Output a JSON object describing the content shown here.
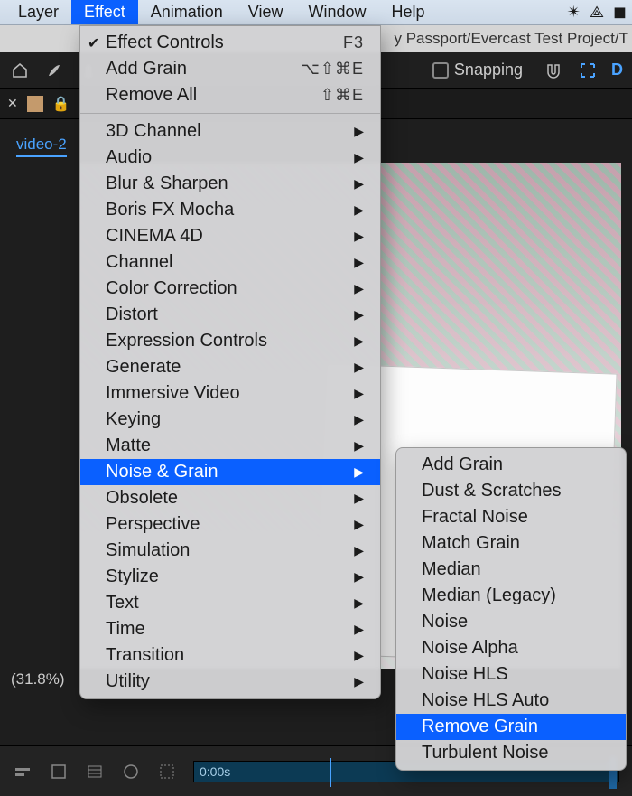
{
  "menubar": {
    "items": [
      "Layer",
      "Effect",
      "Animation",
      "View",
      "Window",
      "Help"
    ],
    "active_index": 1
  },
  "pathbar": {
    "text": "y Passport/Evercast Test Project/T"
  },
  "toolbar": {
    "snapping_label": "Snapping",
    "right_letter": "D"
  },
  "project_tab": {
    "label": "video-2"
  },
  "zoom": {
    "label": "(31.8%)"
  },
  "timeline": {
    "time_label": "0:00s"
  },
  "effect_menu": {
    "top": [
      {
        "label": "Effect Controls",
        "checked": true,
        "shortcut": "F3"
      },
      {
        "label": "Add Grain",
        "shortcut": "⌥⇧⌘E"
      },
      {
        "label": "Remove All",
        "shortcut": "⇧⌘E"
      }
    ],
    "categories": [
      {
        "label": "3D Channel"
      },
      {
        "label": "Audio"
      },
      {
        "label": "Blur & Sharpen"
      },
      {
        "label": "Boris FX Mocha"
      },
      {
        "label": "CINEMA 4D"
      },
      {
        "label": "Channel"
      },
      {
        "label": "Color Correction"
      },
      {
        "label": "Distort"
      },
      {
        "label": "Expression Controls"
      },
      {
        "label": "Generate"
      },
      {
        "label": "Immersive Video"
      },
      {
        "label": "Keying"
      },
      {
        "label": "Matte"
      },
      {
        "label": "Noise & Grain",
        "active": true
      },
      {
        "label": "Obsolete"
      },
      {
        "label": "Perspective"
      },
      {
        "label": "Simulation"
      },
      {
        "label": "Stylize"
      },
      {
        "label": "Text"
      },
      {
        "label": "Time"
      },
      {
        "label": "Transition"
      },
      {
        "label": "Utility"
      }
    ]
  },
  "noise_grain_submenu": {
    "items": [
      {
        "label": "Add Grain"
      },
      {
        "label": "Dust & Scratches"
      },
      {
        "label": "Fractal Noise"
      },
      {
        "label": "Match Grain"
      },
      {
        "label": "Median"
      },
      {
        "label": "Median (Legacy)"
      },
      {
        "label": "Noise"
      },
      {
        "label": "Noise Alpha"
      },
      {
        "label": "Noise HLS"
      },
      {
        "label": "Noise HLS Auto"
      },
      {
        "label": "Remove Grain",
        "active": true
      },
      {
        "label": "Turbulent Noise"
      }
    ]
  }
}
